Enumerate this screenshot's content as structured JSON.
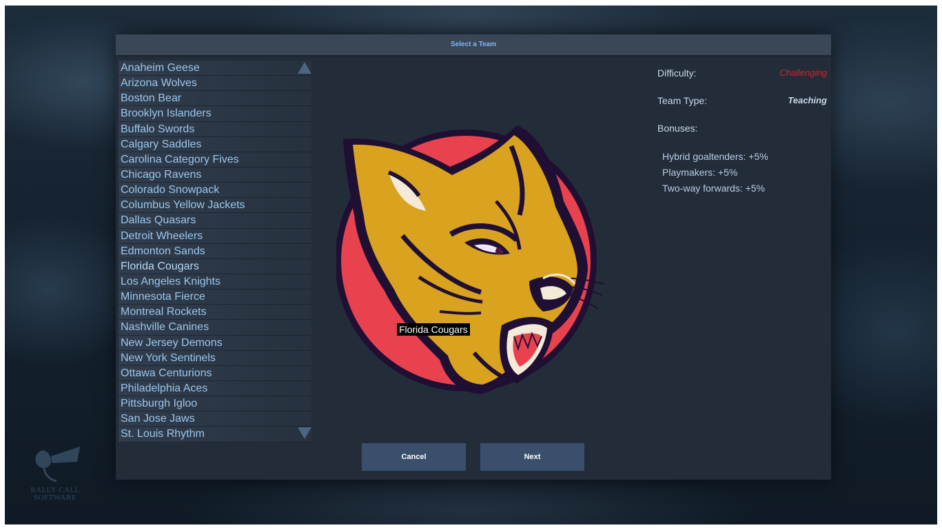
{
  "dialog": {
    "title": "Select a Team"
  },
  "teams": [
    "Anaheim Geese",
    "Arizona Wolves",
    "Boston Bear",
    "Brooklyn Islanders",
    "Buffalo Swords",
    "Calgary Saddles",
    "Carolina Category Fives",
    "Chicago Ravens",
    "Colorado Snowpack",
    "Columbus Yellow Jackets",
    "Dallas Quasars",
    "Detroit Wheelers",
    "Edmonton Sands",
    "Florida Cougars",
    "Los Angeles Knights",
    "Minnesota Fierce",
    "Montreal Rockets",
    "Nashville Canines",
    "New Jersey Demons",
    "New York Sentinels",
    "Ottawa Centurions",
    "Philadelphia Aces",
    "Pittsburgh Igloo",
    "San Jose Jaws",
    "St. Louis Rhythm"
  ],
  "selected_team": {
    "name": "Florida Cougars",
    "tooltip": "Florida Cougars",
    "logo_icon": "cougar-logo-icon"
  },
  "details": {
    "difficulty_label": "Difficulty:",
    "difficulty_value": "Challenging",
    "difficulty_color": "#d8202a",
    "team_type_label": "Team Type:",
    "team_type_value": "Teaching",
    "bonuses_label": "Bonuses:",
    "bonuses": [
      "Hybrid goaltenders: +5%",
      "Playmakers: +5%",
      "Two-way forwards: +5%"
    ]
  },
  "buttons": {
    "cancel": "Cancel",
    "next": "Next"
  },
  "icons": {
    "scroll_up": "triangle-up-icon",
    "scroll_down": "triangle-down-icon"
  },
  "watermark": {
    "line1": "RALLY CALL",
    "line2": "SOFTWARE"
  },
  "colors": {
    "title_text": "#7fb6f0",
    "list_text": "#9cc6ec",
    "logo_ring": "#e8424f",
    "logo_fur": "#d9a21f",
    "logo_outline": "#1f0f33"
  }
}
